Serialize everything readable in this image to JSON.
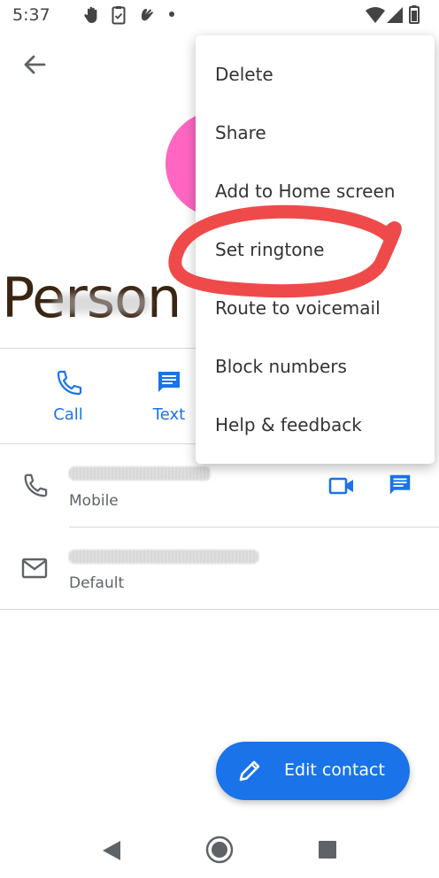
{
  "status_bar": {
    "time": "5:37",
    "icons": [
      "hand-icon",
      "clipboard-icon",
      "gesture-icon",
      "dot-icon",
      "wifi-icon",
      "signal-icon",
      "battery-icon"
    ]
  },
  "header": {
    "back_icon": "arrow-left-icon"
  },
  "contact": {
    "name": "Person",
    "avatar_color": "#ff66c2"
  },
  "actions": [
    {
      "label": "Call",
      "icon": "phone-icon"
    },
    {
      "label": "Text",
      "icon": "message-icon"
    }
  ],
  "details": {
    "phone": {
      "label": "Mobile",
      "icon": "phone-icon",
      "secondary_icons": [
        "video-icon",
        "message-icon"
      ]
    },
    "email": {
      "label": "Default",
      "icon": "mail-icon"
    }
  },
  "menu": {
    "items": [
      "Delete",
      "Share",
      "Add to Home screen",
      "Set ringtone",
      "Route to voicemail",
      "Block numbers",
      "Help & feedback"
    ]
  },
  "annotation": {
    "highlighted_item": "Set ringtone",
    "color": "#ef4a4a"
  },
  "fab": {
    "label": "Edit contact",
    "icon": "pencil-icon",
    "color": "#1a73e8"
  },
  "nav_bar": {
    "icons": [
      "back-triangle-icon",
      "home-circle-icon",
      "recents-square-icon"
    ]
  }
}
